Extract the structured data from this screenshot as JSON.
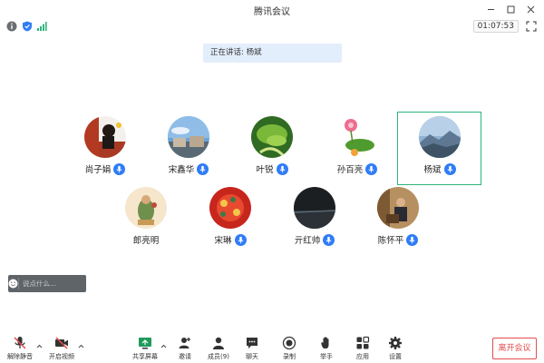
{
  "window": {
    "title": "腾讯会议"
  },
  "status": {
    "timer": "01:07:53"
  },
  "speaking": {
    "label": "正在讲话:",
    "name": "杨斌"
  },
  "participants": [
    {
      "name": "尚子娟",
      "muted": false
    },
    {
      "name": "宋鑫华",
      "muted": false
    },
    {
      "name": "叶锐",
      "muted": false
    },
    {
      "name": "孙百亮",
      "muted": false
    },
    {
      "name": "杨斌",
      "muted": false,
      "selected": true
    },
    {
      "name": "郎亮明",
      "muted": true
    },
    {
      "name": "宋琳",
      "muted": false
    },
    {
      "name": "亓红帅",
      "muted": false
    },
    {
      "name": "陈怀平",
      "muted": false
    }
  ],
  "chat": {
    "placeholder": "说点什么..."
  },
  "toolbar": {
    "unmute": "解除静音",
    "start_video": "开启视频",
    "share_screen": "共享屏幕",
    "invite": "邀请",
    "members": "成员(9)",
    "chat": "聊天",
    "record": "录制",
    "raise_hand": "举手",
    "apps": "应用",
    "settings": "设置",
    "leave": "离开会议"
  },
  "colors": {
    "accent": "#2f7cf6",
    "selected_border": "#2db37c",
    "leave": "#e34d4d"
  }
}
